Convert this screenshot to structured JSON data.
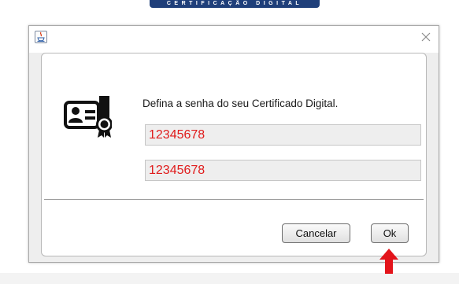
{
  "banner": {
    "text": "CERTIFICAÇÃO DIGITAL"
  },
  "window": {
    "icon": "java-icon"
  },
  "dialog": {
    "message": "Defina a senha do seu Certificado Digital.",
    "password_field_1": {
      "value": "12345678"
    },
    "password_field_2": {
      "value": "12345678"
    },
    "cancel_label": "Cancelar",
    "ok_label": "Ok"
  },
  "icons": {
    "certificate": "certificate-icon",
    "close": "close-icon",
    "annotation_arrow": "red-arrow-up-icon"
  },
  "colors": {
    "input_text": "#e01b1b",
    "arrow": "#e3141b",
    "banner_bg": "#1f3f7a"
  }
}
